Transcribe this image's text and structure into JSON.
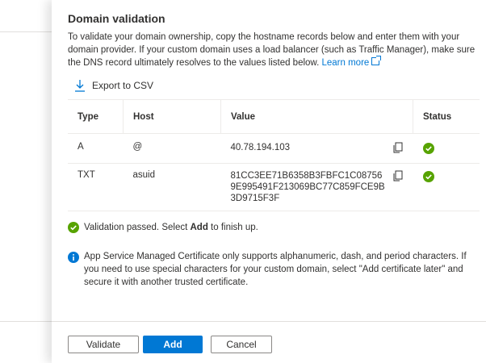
{
  "panel": {
    "title": "Domain validation",
    "description": "To validate your domain ownership, copy the hostname records below and enter them with your domain provider. If your custom domain uses a load balancer (such as Traffic Manager), make sure the DNS record ultimately resolves to the values listed below.",
    "learn_more": "Learn more",
    "export_label": "Export to CSV"
  },
  "table": {
    "headers": [
      "Type",
      "Host",
      "Value",
      "Status"
    ],
    "rows": [
      {
        "type": "A",
        "host": "@",
        "value": "40.78.194.103",
        "status": "check-icon"
      },
      {
        "type": "TXT",
        "host": "asuid",
        "value": "81CC3EE71B6358B3FBFC1C087569E995491F213069BC77C859FCE9B3D9715F3F",
        "status": "check-icon"
      }
    ]
  },
  "validation": {
    "prefix": "Validation passed. Select ",
    "bold": "Add",
    "suffix": " to finish up."
  },
  "info": {
    "text": "App Service Managed Certificate only supports alphanumeric, dash, and period characters. If you need to use special characters for your custom domain, select \"Add certificate later\" and secure it with another trusted certificate."
  },
  "buttons": {
    "validate": "Validate",
    "add": "Add",
    "cancel": "Cancel"
  },
  "colors": {
    "accent": "#0078d4",
    "success": "#57a300"
  }
}
